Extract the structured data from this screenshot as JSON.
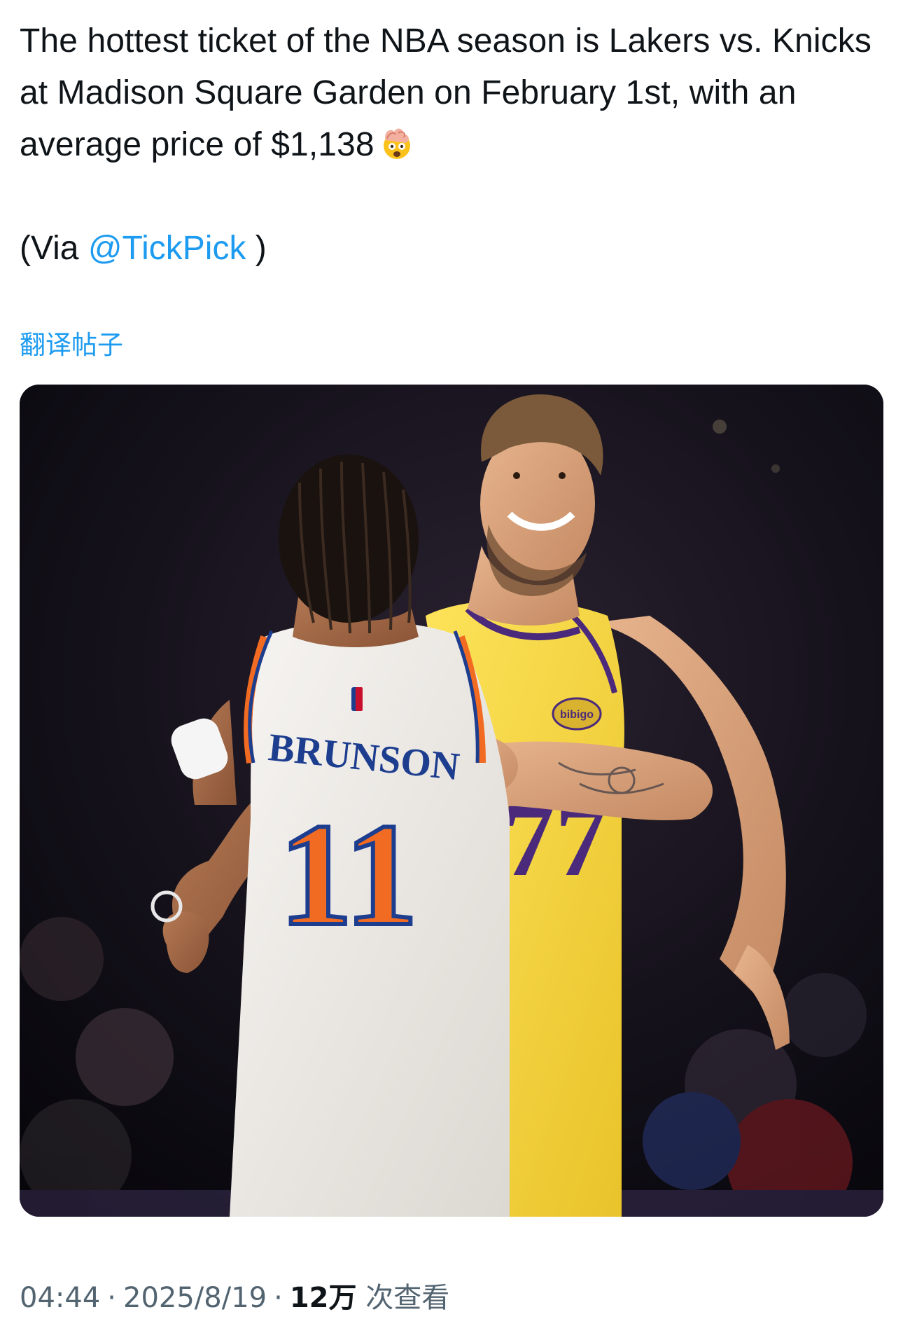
{
  "tweet": {
    "text": "The hottest ticket of the NBA season is Lakers vs. Knicks at Madison Square Garden on February 1st, with an average price of $1,138",
    "emoji": "exploding-head-emoji",
    "via_prefix": "(Via ",
    "via_handle": "@TickPick",
    "via_suffix": " )",
    "translate_label": "翻译帖子"
  },
  "media": {
    "jersey_left_name": "BRUNSON",
    "jersey_left_number": "11",
    "jersey_right_number": "77",
    "sponsor_patch": "bibigo",
    "colors": {
      "knicks_orange": "#f26b22",
      "knicks_blue": "#1d3d8f",
      "lakers_gold": "#f8d640",
      "lakers_purple": "#4b2a7b"
    }
  },
  "meta": {
    "time": "04:44",
    "separator": "·",
    "date": "2025/8/19",
    "views_count": "12万",
    "views_label": " 次查看"
  },
  "colors": {
    "link": "#1d9bf0",
    "muted": "#536471",
    "text": "#0f1419"
  }
}
